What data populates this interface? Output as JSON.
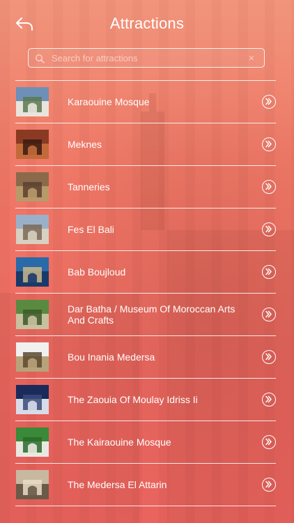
{
  "header": {
    "title": "Attractions",
    "back_icon": "back-arrow-icon"
  },
  "search": {
    "placeholder": "Search for attractions",
    "value": "",
    "icon": "search-icon",
    "clear_icon": "clear-icon",
    "clear_glyph": "×"
  },
  "attractions": [
    {
      "name": "Karaouine Mosque",
      "thumb_colors": [
        "#6d8fb8",
        "#e8e4dc",
        "#5a7a50"
      ]
    },
    {
      "name": "Meknes",
      "thumb_colors": [
        "#8a3a22",
        "#c26a3a",
        "#3a1a12"
      ]
    },
    {
      "name": "Tanneries",
      "thumb_colors": [
        "#8a6a4a",
        "#b89a6a",
        "#5a4030"
      ]
    },
    {
      "name": "Fes El Bali",
      "thumb_colors": [
        "#9ab0c8",
        "#d8d0c0",
        "#7a6a58"
      ]
    },
    {
      "name": "Bab Boujloud",
      "thumb_colors": [
        "#2a6aa8",
        "#1a3a6a",
        "#c8b88a"
      ]
    },
    {
      "name": "Dar Batha / Museum Of Moroccan Arts And Crafts",
      "thumb_colors": [
        "#5a8a40",
        "#c8c0a0",
        "#3a5a28"
      ]
    },
    {
      "name": "Bou Inania Medersa",
      "thumb_colors": [
        "#f0f0f0",
        "#b8a27a",
        "#5a4a30"
      ]
    },
    {
      "name": "The Zaouia Of Moulay Idriss Ii",
      "thumb_colors": [
        "#1a2a5a",
        "#d8dce8",
        "#3a4a7a"
      ]
    },
    {
      "name": "The Kairaouine Mosque",
      "thumb_colors": [
        "#3a8a3a",
        "#e8e8e0",
        "#2a6a2a"
      ]
    },
    {
      "name": "The Medersa El Attarin",
      "thumb_colors": [
        "#c8b8a0",
        "#6a5a48",
        "#e8dcc8"
      ]
    }
  ],
  "row_action_icon": "chevron-right-circle-icon",
  "colors": {
    "background_top": "#f08a72",
    "background_bottom": "#ee6560",
    "foreground": "#ffffff"
  }
}
